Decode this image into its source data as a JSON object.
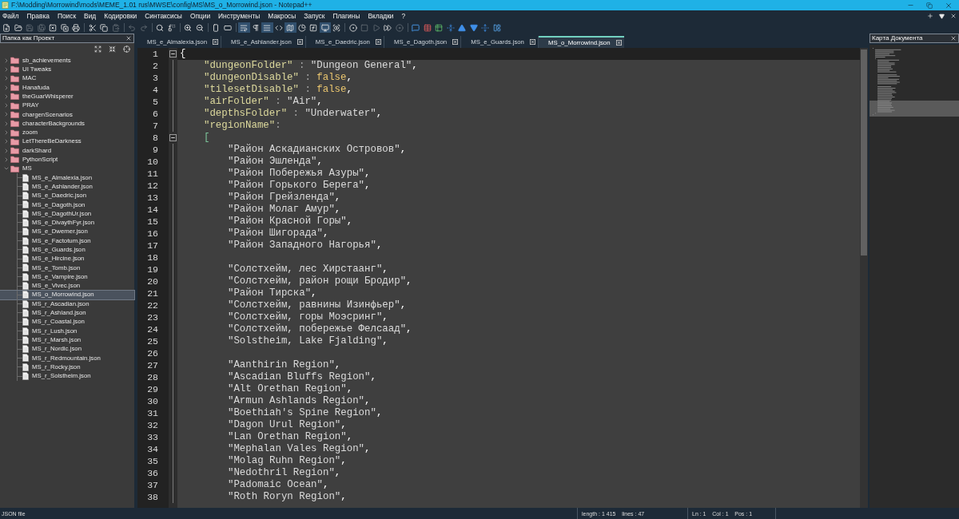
{
  "window": {
    "title": "F:\\Modding\\Morrowind\\mods\\MEME_1.01 rus\\MWSE\\config\\MS\\MS_o_Morrowind.json - Notepad++"
  },
  "menu": [
    "Файл",
    "Правка",
    "Поиск",
    "Вид",
    "Кодировки",
    "Синтаксисы",
    "Опции",
    "Инструменты",
    "Макросы",
    "Запуск",
    "Плагины",
    "Вкладки",
    "?"
  ],
  "toolbar": [
    {
      "buttons": [
        {
          "disabled": false,
          "pressed": false
        },
        {
          "disabled": false,
          "pressed": false
        },
        {
          "disabled": true,
          "pressed": false
        },
        {
          "disabled": true,
          "pressed": false
        },
        {
          "disabled": false,
          "pressed": false
        },
        {
          "disabled": false,
          "pressed": false
        },
        {
          "disabled": false,
          "pressed": false
        }
      ]
    },
    {
      "buttons": [
        {
          "disabled": false,
          "pressed": false
        },
        {
          "disabled": false,
          "pressed": false
        },
        {
          "disabled": true,
          "pressed": false
        }
      ]
    },
    {
      "buttons": [
        {
          "disabled": true,
          "pressed": false
        },
        {
          "disabled": true,
          "pressed": false
        }
      ]
    },
    {
      "buttons": [
        {
          "disabled": false,
          "pressed": false
        },
        {
          "disabled": false,
          "pressed": false
        }
      ]
    },
    {
      "buttons": [
        {
          "disabled": false,
          "pressed": false
        },
        {
          "disabled": false,
          "pressed": false
        }
      ]
    },
    {
      "buttons": [
        {
          "disabled": false,
          "pressed": false
        },
        {
          "disabled": false,
          "pressed": false
        }
      ]
    },
    {
      "buttons": [
        {
          "disabled": false,
          "pressed": true
        },
        {
          "disabled": false,
          "pressed": false
        },
        {
          "disabled": false,
          "pressed": true
        },
        {
          "disabled": false,
          "pressed": false
        },
        {
          "disabled": false,
          "pressed": true
        },
        {
          "disabled": false,
          "pressed": false
        },
        {
          "disabled": false,
          "pressed": false
        },
        {
          "disabled": false,
          "pressed": true
        },
        {
          "disabled": false,
          "pressed": false
        }
      ]
    },
    {
      "buttons": [
        {
          "disabled": false,
          "pressed": false
        },
        {
          "disabled": true,
          "pressed": false
        },
        {
          "disabled": true,
          "pressed": false
        },
        {
          "disabled": false,
          "pressed": false
        },
        {
          "disabled": true,
          "pressed": false
        }
      ]
    },
    {
      "buttons": [
        {
          "disabled": false,
          "pressed": false
        },
        {
          "disabled": false,
          "pressed": false
        },
        {
          "disabled": false,
          "pressed": false
        },
        {
          "disabled": false,
          "pressed": false
        },
        {
          "disabled": false,
          "pressed": false
        },
        {
          "disabled": false,
          "pressed": false
        },
        {
          "disabled": false,
          "pressed": false
        },
        {
          "disabled": false,
          "pressed": false
        }
      ]
    }
  ],
  "project_panel": {
    "title": "Папка как Проект",
    "tree": [
      {
        "label": "sb_achievements",
        "kind": "folder",
        "expanded": false,
        "selected": false
      },
      {
        "label": "UI Tweaks",
        "kind": "folder",
        "expanded": false,
        "selected": false
      },
      {
        "label": "MAC",
        "kind": "folder",
        "expanded": false,
        "selected": false
      },
      {
        "label": "Hanafuda",
        "kind": "folder",
        "expanded": false,
        "selected": false
      },
      {
        "label": "theGuarWhisperer",
        "kind": "folder",
        "expanded": false,
        "selected": false
      },
      {
        "label": "PRAY",
        "kind": "folder",
        "expanded": false,
        "selected": false
      },
      {
        "label": "chargenScenarios",
        "kind": "folder",
        "expanded": false,
        "selected": false
      },
      {
        "label": "characterBackgrounds",
        "kind": "folder",
        "expanded": false,
        "selected": false
      },
      {
        "label": "zoom",
        "kind": "folder",
        "expanded": false,
        "selected": false
      },
      {
        "label": "LetThereBeDarkness",
        "kind": "folder",
        "expanded": false,
        "selected": false
      },
      {
        "label": "darkShard",
        "kind": "folder",
        "expanded": false,
        "selected": false
      },
      {
        "label": "PythonScript",
        "kind": "folder",
        "expanded": false,
        "selected": false
      },
      {
        "label": "MS",
        "kind": "folder",
        "expanded": true,
        "selected": false,
        "children": [
          {
            "label": "MS_e_Almalexia.json",
            "kind": "file",
            "selected": false
          },
          {
            "label": "MS_e_Ashlander.json",
            "kind": "file",
            "selected": false
          },
          {
            "label": "MS_e_Daedric.json",
            "kind": "file",
            "selected": false
          },
          {
            "label": "MS_e_Dagoth.json",
            "kind": "file",
            "selected": false
          },
          {
            "label": "MS_e_DagothUr.json",
            "kind": "file",
            "selected": false
          },
          {
            "label": "MS_e_DivaythFyr.json",
            "kind": "file",
            "selected": false
          },
          {
            "label": "MS_e_Dwemer.json",
            "kind": "file",
            "selected": false
          },
          {
            "label": "MS_e_Factotum.json",
            "kind": "file",
            "selected": false
          },
          {
            "label": "MS_e_Guards.json",
            "kind": "file",
            "selected": false
          },
          {
            "label": "MS_e_Hircine.json",
            "kind": "file",
            "selected": false
          },
          {
            "label": "MS_e_Tomb.json",
            "kind": "file",
            "selected": false
          },
          {
            "label": "MS_e_Vampire.json",
            "kind": "file",
            "selected": false
          },
          {
            "label": "MS_e_Vivec.json",
            "kind": "file",
            "selected": false
          },
          {
            "label": "MS_o_Morrowind.json",
            "kind": "file",
            "selected": true
          },
          {
            "label": "MS_r_Ascadian.json",
            "kind": "file",
            "selected": false
          },
          {
            "label": "MS_r_Ashland.json",
            "kind": "file",
            "selected": false
          },
          {
            "label": "MS_r_Coastal.json",
            "kind": "file",
            "selected": false
          },
          {
            "label": "MS_r_Lush.json",
            "kind": "file",
            "selected": false
          },
          {
            "label": "MS_r_Marsh.json",
            "kind": "file",
            "selected": false
          },
          {
            "label": "MS_r_Nordic.json",
            "kind": "file",
            "selected": false
          },
          {
            "label": "MS_r_Redmountain.json",
            "kind": "file",
            "selected": false
          },
          {
            "label": "MS_r_Rocky.json",
            "kind": "file",
            "selected": false
          },
          {
            "label": "MS_r_Solstheim.json",
            "kind": "file",
            "selected": false
          }
        ]
      }
    ]
  },
  "tabs": [
    {
      "label": "MS_e_Almalexia.json",
      "selected": false
    },
    {
      "label": "MS_e_Ashlander.json",
      "selected": false
    },
    {
      "label": "MS_e_Daedric.json",
      "selected": false
    },
    {
      "label": "MS_e_Dagoth.json",
      "selected": false
    },
    {
      "label": "MS_e_Guards.json",
      "selected": false
    },
    {
      "label": "MS_o_Morrowind.json",
      "selected": true
    }
  ],
  "editor": {
    "lines": [
      {
        "number": "1",
        "current": true,
        "tokens": [
          {
            "kind": "brace",
            "text": "{"
          }
        ],
        "children": [
          {
            "number": "2",
            "current": false,
            "tokens": [
              {
                "kind": "key",
                "text": "\"dungeonFolder\""
              },
              {
                "kind": "operator",
                "text": " : "
              },
              {
                "kind": "string",
                "text": "\"Dungeon General\""
              },
              {
                "kind": "delimiter",
                "text": ","
              }
            ]
          },
          {
            "number": "3",
            "current": false,
            "tokens": [
              {
                "kind": "key",
                "text": "\"dungeonDisable\""
              },
              {
                "kind": "operator",
                "text": " : "
              },
              {
                "kind": "keyword",
                "text": "false"
              },
              {
                "kind": "delimiter",
                "text": ","
              }
            ]
          },
          {
            "number": "4",
            "current": false,
            "tokens": [
              {
                "kind": "key",
                "text": "\"tilesetDisable\""
              },
              {
                "kind": "operator",
                "text": " : "
              },
              {
                "kind": "keyword",
                "text": "false"
              },
              {
                "kind": "delimiter",
                "text": ","
              }
            ]
          },
          {
            "number": "5",
            "current": false,
            "tokens": [
              {
                "kind": "key",
                "text": "\"airFolder\""
              },
              {
                "kind": "operator",
                "text": " : "
              },
              {
                "kind": "string",
                "text": "\"Air\""
              },
              {
                "kind": "delimiter",
                "text": ","
              }
            ]
          },
          {
            "number": "6",
            "current": false,
            "tokens": [
              {
                "kind": "key",
                "text": "\"depthsFolder\""
              },
              {
                "kind": "operator",
                "text": " : "
              },
              {
                "kind": "string",
                "text": "\"Underwater\""
              },
              {
                "kind": "delimiter",
                "text": ","
              }
            ]
          },
          {
            "number": "7",
            "current": false,
            "tokens": [
              {
                "kind": "key",
                "text": "\"regionName\""
              },
              {
                "kind": "operator",
                "text": ":"
              }
            ]
          },
          {
            "number": "8",
            "current": false,
            "tokens": [
              {
                "kind": "bracket",
                "text": "["
              }
            ],
            "children": [
              {
                "number": "9",
                "current": false,
                "tokens": [
                  {
                    "kind": "string",
                    "text": "\"Район Аскадианских Островов\""
                  },
                  {
                    "kind": "delimiter",
                    "text": ","
                  }
                ]
              },
              {
                "number": "10",
                "current": false,
                "tokens": [
                  {
                    "kind": "string",
                    "text": "\"Район Эшленда\""
                  },
                  {
                    "kind": "delimiter",
                    "text": ","
                  }
                ]
              },
              {
                "number": "11",
                "current": false,
                "tokens": [
                  {
                    "kind": "string",
                    "text": "\"Район Побережья Азуры\""
                  },
                  {
                    "kind": "delimiter",
                    "text": ","
                  }
                ]
              },
              {
                "number": "12",
                "current": false,
                "tokens": [
                  {
                    "kind": "string",
                    "text": "\"Район Горького Берега\""
                  },
                  {
                    "kind": "delimiter",
                    "text": ","
                  }
                ]
              },
              {
                "number": "13",
                "current": false,
                "tokens": [
                  {
                    "kind": "string",
                    "text": "\"Район Грейзленда\""
                  },
                  {
                    "kind": "delimiter",
                    "text": ","
                  }
                ]
              },
              {
                "number": "14",
                "current": false,
                "tokens": [
                  {
                    "kind": "string",
                    "text": "\"Район Молаг Амур\""
                  },
                  {
                    "kind": "delimiter",
                    "text": ","
                  }
                ]
              },
              {
                "number": "15",
                "current": false,
                "tokens": [
                  {
                    "kind": "string",
                    "text": "\"Район Красной Горы\""
                  },
                  {
                    "kind": "delimiter",
                    "text": ","
                  }
                ]
              },
              {
                "number": "16",
                "current": false,
                "tokens": [
                  {
                    "kind": "string",
                    "text": "\"Район Шигорада\""
                  },
                  {
                    "kind": "delimiter",
                    "text": ","
                  }
                ]
              },
              {
                "number": "17",
                "current": false,
                "tokens": [
                  {
                    "kind": "string",
                    "text": "\"Район Западного Нагорья\""
                  },
                  {
                    "kind": "delimiter",
                    "text": ","
                  }
                ]
              },
              {
                "number": "18",
                "current": false
              },
              {
                "number": "19",
                "current": false,
                "tokens": [
                  {
                    "kind": "string",
                    "text": "\"Солстхейм, лес Хирстаанг\""
                  },
                  {
                    "kind": "delimiter",
                    "text": ","
                  }
                ]
              },
              {
                "number": "20",
                "current": false,
                "tokens": [
                  {
                    "kind": "string",
                    "text": "\"Солстхейм, район рощи Бродир\""
                  },
                  {
                    "kind": "delimiter",
                    "text": ","
                  }
                ]
              },
              {
                "number": "21",
                "current": false,
                "tokens": [
                  {
                    "kind": "string",
                    "text": "\"Район Тирска\""
                  },
                  {
                    "kind": "delimiter",
                    "text": ","
                  }
                ]
              },
              {
                "number": "22",
                "current": false,
                "tokens": [
                  {
                    "kind": "string",
                    "text": "\"Солстхейм, равнины Изинфьер\""
                  },
                  {
                    "kind": "delimiter",
                    "text": ","
                  }
                ]
              },
              {
                "number": "23",
                "current": false,
                "tokens": [
                  {
                    "kind": "string",
                    "text": "\"Солстхейм, горы Моэсринг\""
                  },
                  {
                    "kind": "delimiter",
                    "text": ","
                  }
                ]
              },
              {
                "number": "24",
                "current": false,
                "tokens": [
                  {
                    "kind": "string",
                    "text": "\"Солстхейм, побережье Фелсаад\""
                  },
                  {
                    "kind": "delimiter",
                    "text": ","
                  }
                ]
              },
              {
                "number": "25",
                "current": false,
                "tokens": [
                  {
                    "kind": "string",
                    "text": "\"Solstheim, Lake Fjalding\""
                  },
                  {
                    "kind": "delimiter",
                    "text": ","
                  }
                ]
              },
              {
                "number": "26",
                "current": false
              },
              {
                "number": "27",
                "current": false,
                "tokens": [
                  {
                    "kind": "string",
                    "text": "\"Aanthirin Region\""
                  },
                  {
                    "kind": "delimiter",
                    "text": ","
                  }
                ]
              },
              {
                "number": "28",
                "current": false,
                "tokens": [
                  {
                    "kind": "string",
                    "text": "\"Ascadian Bluffs Region\""
                  },
                  {
                    "kind": "delimiter",
                    "text": ","
                  }
                ]
              },
              {
                "number": "29",
                "current": false,
                "tokens": [
                  {
                    "kind": "string",
                    "text": "\"Alt Orethan Region\""
                  },
                  {
                    "kind": "delimiter",
                    "text": ","
                  }
                ]
              },
              {
                "number": "30",
                "current": false,
                "tokens": [
                  {
                    "kind": "string",
                    "text": "\"Armun Ashlands Region\""
                  },
                  {
                    "kind": "delimiter",
                    "text": ","
                  }
                ]
              },
              {
                "number": "31",
                "current": false,
                "tokens": [
                  {
                    "kind": "string",
                    "text": "\"Boethiah's Spine Region\""
                  },
                  {
                    "kind": "delimiter",
                    "text": ","
                  }
                ]
              },
              {
                "number": "32",
                "current": false,
                "tokens": [
                  {
                    "kind": "string",
                    "text": "\"Dagon Urul Region\""
                  },
                  {
                    "kind": "delimiter",
                    "text": ","
                  }
                ]
              },
              {
                "number": "33",
                "current": false,
                "tokens": [
                  {
                    "kind": "string",
                    "text": "\"Lan Orethan Region\""
                  },
                  {
                    "kind": "delimiter",
                    "text": ","
                  }
                ]
              },
              {
                "number": "34",
                "current": false,
                "tokens": [
                  {
                    "kind": "string",
                    "text": "\"Mephalan Vales Region\""
                  },
                  {
                    "kind": "delimiter",
                    "text": ","
                  }
                ]
              },
              {
                "number": "35",
                "current": false,
                "tokens": [
                  {
                    "kind": "string",
                    "text": "\"Molag Ruhn Region\""
                  },
                  {
                    "kind": "delimiter",
                    "text": ","
                  }
                ]
              },
              {
                "number": "36",
                "current": false,
                "tokens": [
                  {
                    "kind": "string",
                    "text": "\"Nedothril Region\""
                  },
                  {
                    "kind": "delimiter",
                    "text": ","
                  }
                ]
              },
              {
                "number": "37",
                "current": false,
                "tokens": [
                  {
                    "kind": "string",
                    "text": "\"Padomaic Ocean\""
                  },
                  {
                    "kind": "delimiter",
                    "text": ","
                  }
                ]
              },
              {
                "number": "38",
                "current": false,
                "tokens": [
                  {
                    "kind": "string",
                    "text": "\"Roth Roryn Region\""
                  },
                  {
                    "kind": "delimiter",
                    "text": ","
                  }
                ]
              }
            ]
          }
        ]
      }
    ]
  },
  "document_map": {
    "title": "Карта Документа"
  },
  "status_bar": {
    "file_type": "JSON file",
    "document_size": "length : 1 415    lines : 47",
    "position": "Ln : 1    Col : 1    Pos : 1"
  }
}
